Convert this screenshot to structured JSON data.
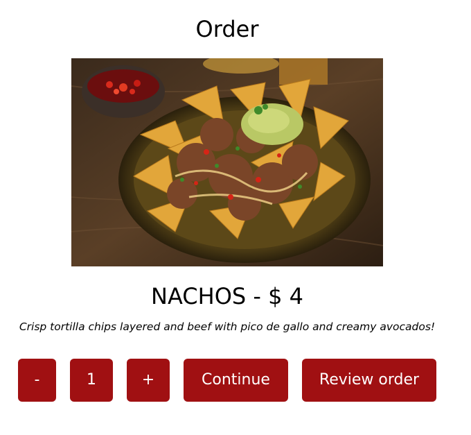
{
  "page": {
    "title": "Order"
  },
  "product": {
    "image_alt": "Nachos",
    "name_price": "NACHOS - $ 4",
    "description": "Crisp tortilla chips layered and beef with pico de gallo and creamy avocados!"
  },
  "controls": {
    "decrease_label": "-",
    "quantity": "1",
    "increase_label": "+",
    "continue_label": "Continue",
    "review_label": "Review order"
  },
  "colors": {
    "button_bg": "#a01012",
    "button_text": "#ffffff",
    "text": "#000000",
    "background": "#ffffff"
  }
}
